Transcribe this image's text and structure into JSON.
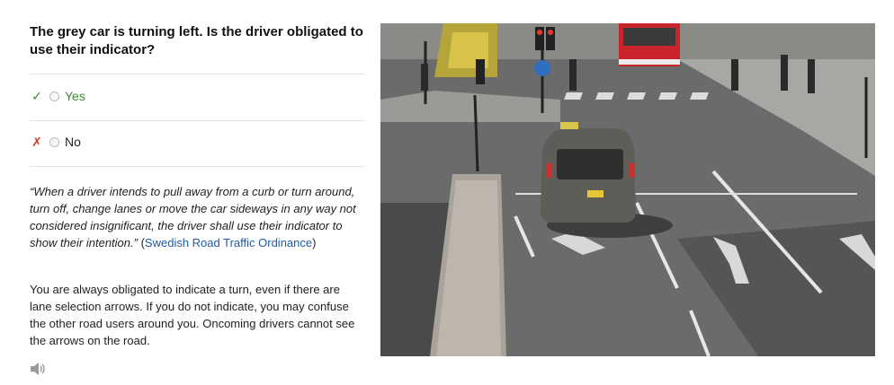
{
  "question": "The grey car is turning left. Is the driver obligated to use their indicator?",
  "options": [
    {
      "mark": "✓",
      "label": "Yes",
      "correct": true
    },
    {
      "mark": "✗",
      "label": "No",
      "correct": false
    }
  ],
  "quote": {
    "text": "“When a driver intends to pull away from a curb or turn around, turn off, change lanes or move the car sideways in any way not considered insignificant, the driver shall use their indicator to show their intention.”",
    "open_paren": "(",
    "source": "Swedish Road Traffic Ordinance",
    "close_paren": ")"
  },
  "explanation": "You are always obligated to indicate a turn, even if there are lane selection arrows. If you do not indicate, you may confuse the other road users around you. Oncoming drivers cannot see the arrows on the road.",
  "audio_icon": "speaker-icon",
  "colors": {
    "correct": "#3a8a2e",
    "wrong": "#d33a2f",
    "link": "#1f5aa8"
  }
}
